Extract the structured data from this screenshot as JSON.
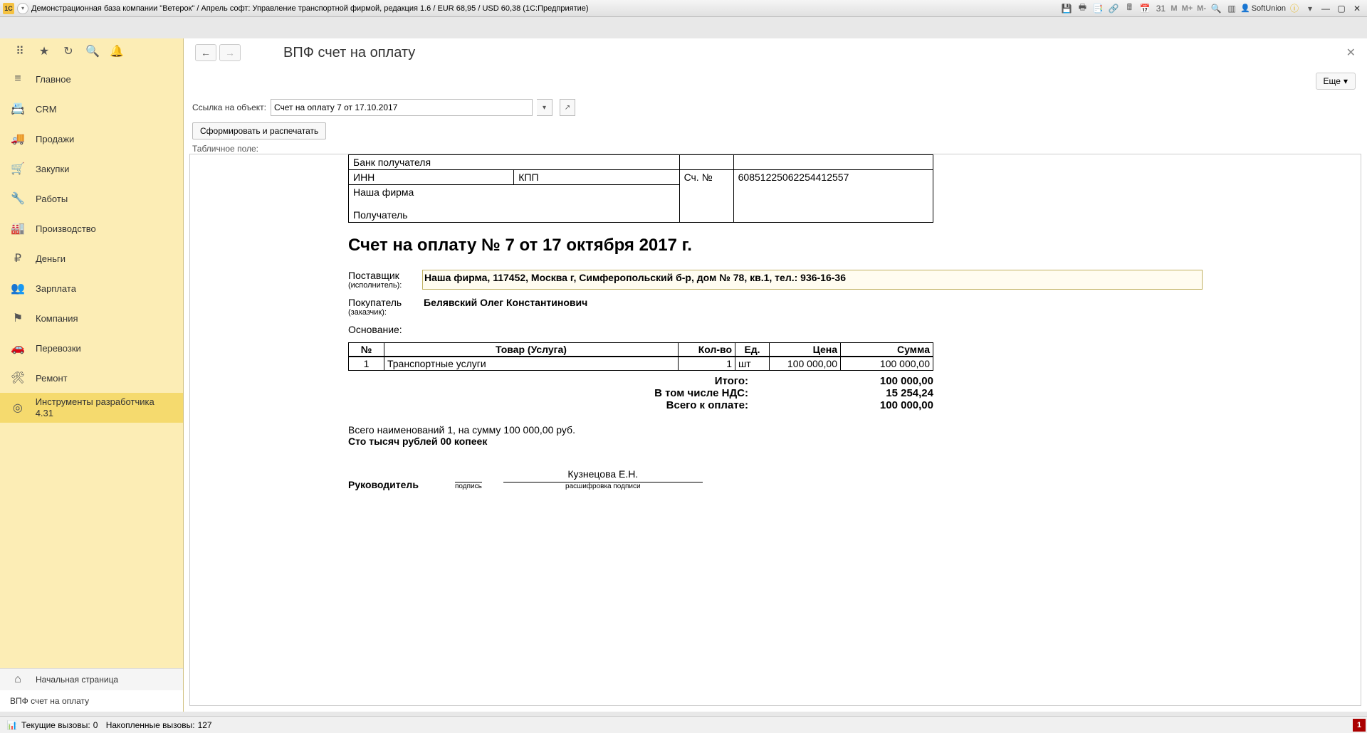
{
  "titlebar": {
    "logo_text": "1C",
    "title": "Демонстрационная база компании \"Ветерок\" / Апрель софт: Управление транспортной фирмой, редакция 1.6 / EUR 68,95 / USD 60,38  (1С:Предприятие)",
    "user": "SoftUnion",
    "memory_btns": [
      "M",
      "M+",
      "M-"
    ]
  },
  "sidebar": {
    "items": [
      {
        "label": "Главное",
        "icon": "≡"
      },
      {
        "label": "CRM",
        "icon": "📇"
      },
      {
        "label": "Продажи",
        "icon": "🚚"
      },
      {
        "label": "Закупки",
        "icon": "🛒"
      },
      {
        "label": "Работы",
        "icon": "🔧"
      },
      {
        "label": "Производство",
        "icon": "🏭"
      },
      {
        "label": "Деньги",
        "icon": "₽"
      },
      {
        "label": "Зарплата",
        "icon": "👥"
      },
      {
        "label": "Компания",
        "icon": "⚑"
      },
      {
        "label": "Перевозки",
        "icon": "🚗"
      },
      {
        "label": "Ремонт",
        "icon": "🛠"
      },
      {
        "label": "Инструменты разработчика 4.31",
        "icon": "◎"
      }
    ],
    "bottom": [
      {
        "label": "Начальная страница",
        "icon": "⌂"
      },
      {
        "label": "ВПФ счет на оплату",
        "icon": ""
      }
    ]
  },
  "main": {
    "page_title": "ВПФ счет на оплату",
    "more_label": "Еще",
    "ref_label": "Ссылка на объект:",
    "ref_value": "Счет на оплату 7 от 17.10.2017",
    "print_btn": "Сформировать и распечатать",
    "table_field_label": "Табличное поле:"
  },
  "invoice": {
    "bank": {
      "bank_recip": "Банк получателя",
      "inn": "ИНН",
      "kpp": "КПП",
      "acct_label": "Сч. №",
      "acct_value": "60851225062254412557",
      "our_firm": "Наша фирма",
      "recipient": "Получатель"
    },
    "title": "Счет на оплату № 7 от 17 октября 2017 г.",
    "supplier_label": "Поставщик",
    "supplier_sub": "(исполнитель):",
    "supplier_value": "Наша фирма,  117452, Москва г, Симферопольский б-р, дом № 78, кв.1,  тел.: 936-16-36",
    "buyer_label": "Покупатель",
    "buyer_sub": "(заказчик):",
    "buyer_value": "Белявский Олег Константинович",
    "basis_label": "Основание:",
    "items_head": {
      "num": "№",
      "name": "Товар (Услуга)",
      "qty": "Кол-во",
      "unit": "Ед.",
      "price": "Цена",
      "sum": "Сумма"
    },
    "items": [
      {
        "num": "1",
        "name": "Транспортные услуги",
        "qty": "1",
        "unit": "шт",
        "price": "100 000,00",
        "sum": "100 000,00"
      }
    ],
    "totals": {
      "itogo_l": "Итого:",
      "itogo_v": "100 000,00",
      "nds_l": "В том числе НДС:",
      "nds_v": "15 254,24",
      "total_l": "Всего к оплате:",
      "total_v": "100 000,00"
    },
    "count_line": "Всего наименований 1, на сумму 100 000,00 руб.",
    "words": "Сто тысяч рублей 00 копеек",
    "sig": {
      "leader": "Руководитель",
      "sign_l": "подпись",
      "name": "Кузнецова Е.Н.",
      "decode_l": "расшифровка подписи"
    }
  },
  "statusbar": {
    "calls_cur_label": "Текущие вызовы:",
    "calls_cur": "0",
    "calls_acc_label": "Накопленные вызовы:",
    "calls_acc": "127",
    "red_val": "1"
  }
}
